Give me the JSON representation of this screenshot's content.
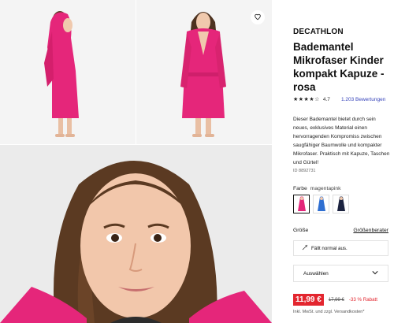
{
  "product": {
    "brand": "DECATHLON",
    "title": "Bademantel Mikrofaser Kinder kompakt Kapuze - rosa",
    "rating_value": "4.7",
    "rating_stars": "★★★★☆",
    "reviews_link": "1.203 Bewertungen",
    "description": "Dieser Bademantel bietet durch sein neues, exklusives Material einen hervorragenden Kompromiss zwischen saugfähiger Baumwolle und kompakter Mikrofaser. Praktisch mit Kapuze, Taschen und Gürtel!",
    "id_label": "ID 8892731"
  },
  "color": {
    "label": "Farbe",
    "selected": "magentapink",
    "swatches": [
      {
        "name": "magentapink",
        "hex": "#e3267a"
      },
      {
        "name": "blau",
        "hex": "#2f6fd1"
      },
      {
        "name": "navy",
        "hex": "#1c2340"
      }
    ]
  },
  "size": {
    "label": "Größe",
    "guide_link": "Größenberater",
    "fit_text": "Fällt normal aus.",
    "select_placeholder": "Auswählen"
  },
  "pricing": {
    "price": "11,99 €",
    "old_price": "17,99 €",
    "discount": "-33 % Rabatt",
    "tax_note": "Inkl. MwSt. und zzgl. Versandkosten*"
  },
  "colors": {
    "accent": "#3643ba",
    "sale": "#e3262f",
    "robe": "#e5267a"
  }
}
